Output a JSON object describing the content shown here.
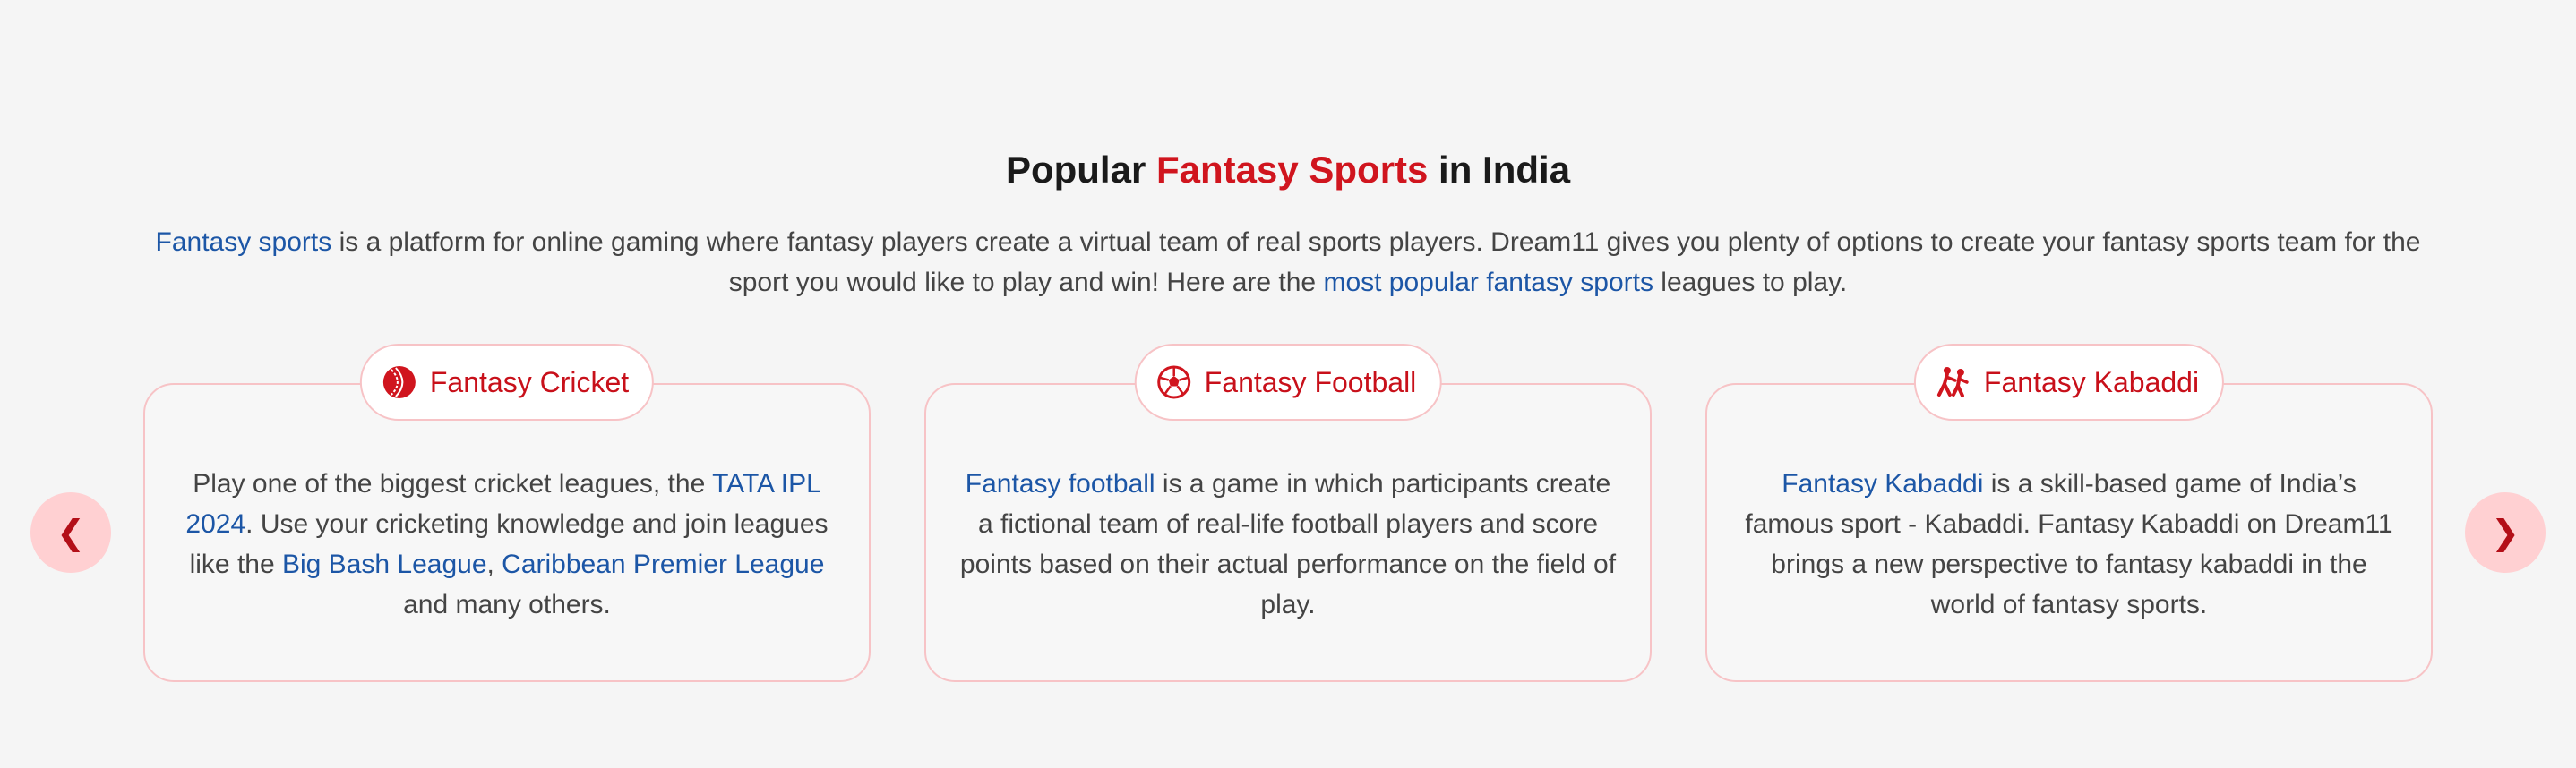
{
  "heading": {
    "part1": "Popular ",
    "accent": "Fantasy Sports",
    "part2": " in India"
  },
  "intro": {
    "link1": "Fantasy sports",
    "text1": " is a platform for online gaming where fantasy players create a virtual team of real sports players. Dream11 gives you plenty of options to create your fantasy sports team for the sport you would like to play and win! Here are the ",
    "link2": "most popular fantasy sports",
    "text2": " leagues to play."
  },
  "carousel": {
    "prev_label": "❮",
    "next_label": "❯"
  },
  "cards": [
    {
      "title": "Fantasy Cricket",
      "icon": "cricket-ball-icon",
      "t1": "Play one of the biggest cricket leagues, the ",
      "l1": "TATA IPL 2024",
      "t2": ". Use your cricketing knowledge and join leagues like the ",
      "l2": "Big Bash League",
      "t3": ", ",
      "l3": "Caribbean Premier League",
      "t4": " and many others."
    },
    {
      "title": "Fantasy Football",
      "icon": "football-icon",
      "l1": "Fantasy football",
      "t1": " is a game in which participants create a fictional team of real-life football players and score points based on their actual performance on the field of play."
    },
    {
      "title": "Fantasy Kabaddi",
      "icon": "kabaddi-players-icon",
      "l1": "Fantasy Kabaddi",
      "t1": " is a skill-based game of India’s famous sport - Kabaddi. Fantasy Kabaddi on Dream11 brings a new perspective to fantasy kabaddi in the world of fantasy sports."
    }
  ],
  "colors": {
    "accent_red": "#d0151e",
    "link_blue": "#1c56a6",
    "border_pink": "#f7c3c6",
    "arrow_bg": "#ffd0d2"
  }
}
